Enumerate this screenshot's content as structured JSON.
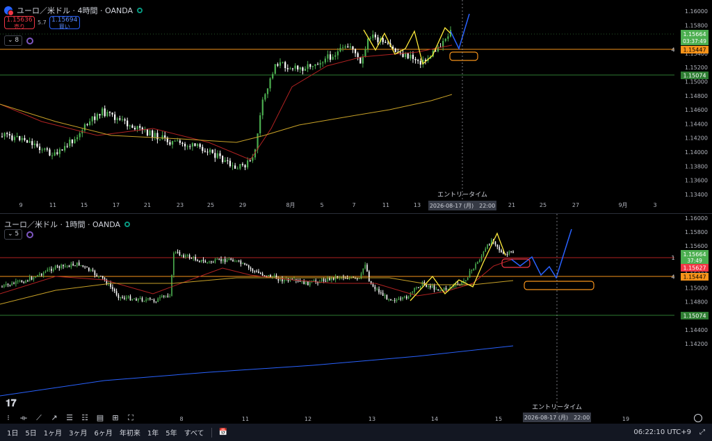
{
  "top": {
    "symbol": "ユーロ／米ドル · 4時間 · OANDA",
    "sell": {
      "price": "1.15636",
      "label": "売り"
    },
    "spread": "5.7",
    "buy": {
      "price": "1.15694",
      "label": "買い"
    },
    "indicator_count": "8",
    "price_axis": [
      "1.16000",
      "1.15800",
      "1.15600",
      "1.15400",
      "1.15200",
      "1.15000",
      "1.14800",
      "1.14600",
      "1.14400",
      "1.14200",
      "1.14000",
      "1.13800",
      "1.13600",
      "1.13400"
    ],
    "time_axis": [
      "9",
      "11",
      "15",
      "17",
      "21",
      "23",
      "25",
      "29",
      "8月",
      "5",
      "7",
      "11",
      "13",
      "17",
      "21",
      "25",
      "27",
      "9月",
      "3"
    ],
    "badges": {
      "last_price": "1.15664",
      "countdown": "03:37:49",
      "orange": "1.15447",
      "green": "1.15074",
      "orange_tag": "4"
    },
    "entry_label": "エントリータイム",
    "entry_time": "2026-08-17 (月)　22:00"
  },
  "bottom": {
    "symbol": "ユーロ／米ドル · 1時間 · OANDA",
    "indicator_count": "5",
    "price_axis": [
      "1.16000",
      "1.15800",
      "1.15600",
      "1.15400",
      "1.15200",
      "1.15000",
      "1.14800",
      "1.14600",
      "1.14400",
      "1.14200"
    ],
    "time_axis": [
      "8",
      "11",
      "12",
      "13",
      "14",
      "15",
      "19"
    ],
    "badges": {
      "last_price": "1.15664",
      "countdown": "37:49",
      "red": "1.15627",
      "orange": "1.15447",
      "green": "1.15074",
      "red_tag": "1",
      "orange_tag": "4"
    },
    "entry_label": "エントリータイム",
    "entry_time": "2026-08-17 (月)　22:00"
  },
  "toolbar": {
    "timeframes": [
      "1日",
      "5日",
      "1ヶ月",
      "3ヶ月",
      "6ヶ月",
      "年初来",
      "1年",
      "5年",
      "すべて"
    ],
    "clock": "06:22:10 UTC+9"
  },
  "colors": {
    "up": "#4caf50",
    "down": "#ffffff",
    "ma_red": "#b22222",
    "ma_yellow": "#c9a227",
    "orange": "#f7931a",
    "green_line": "#2e7d32",
    "blue": "#2962ff"
  }
}
